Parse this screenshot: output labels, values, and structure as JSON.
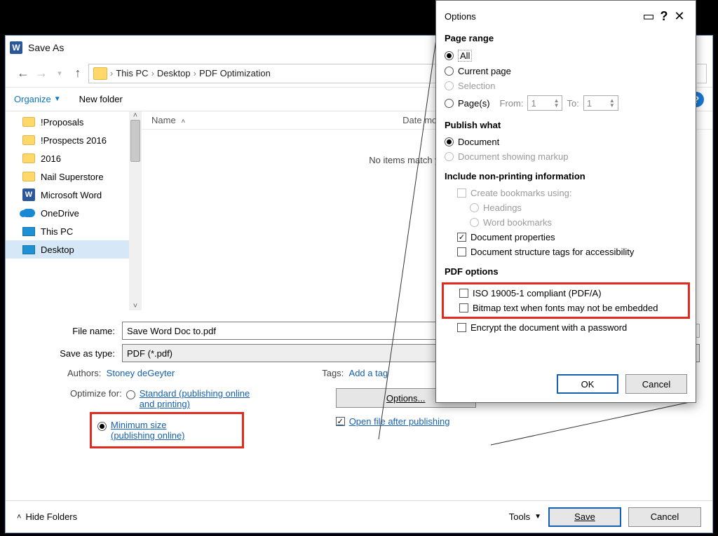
{
  "saveas": {
    "title": "Save As",
    "breadcrumb": [
      "This PC",
      "Desktop",
      "PDF Optimization"
    ],
    "toolbar": {
      "organize": "Organize",
      "newfolder": "New folder"
    },
    "columns": {
      "name": "Name",
      "date": "Date modified"
    },
    "empty": "No items match your search.",
    "tree": [
      {
        "label": "!Proposals",
        "icon": "folder"
      },
      {
        "label": "!Prospects 2016",
        "icon": "folder"
      },
      {
        "label": "2016",
        "icon": "folder"
      },
      {
        "label": "Nail Superstore",
        "icon": "folder"
      },
      {
        "label": "Microsoft Word",
        "icon": "word"
      },
      {
        "label": "OneDrive",
        "icon": "onedrive"
      },
      {
        "label": "This PC",
        "icon": "pc"
      },
      {
        "label": "Desktop",
        "icon": "pc",
        "selected": true
      }
    ],
    "form": {
      "filename_label": "File name:",
      "filename": "Save Word Doc to.pdf",
      "type_label": "Save as type:",
      "type_value": "PDF (*.pdf)",
      "authors_label": "Authors:",
      "authors": "Stoney deGeyter",
      "tags_label": "Tags:",
      "tags": "Add a tag",
      "optimize_label": "Optimize for:",
      "opt_standard": "Standard (publishing online and printing)",
      "opt_min1": "Minimum size",
      "opt_min2": "(publishing online)",
      "options_btn": "Options...",
      "open_after": "Open file after publishing"
    },
    "bottom": {
      "hide": "Hide Folders",
      "tools": "Tools",
      "save": "Save",
      "cancel": "Cancel"
    }
  },
  "options": {
    "title": "Options",
    "page_range": "Page range",
    "all": "All",
    "current": "Current page",
    "selection": "Selection",
    "pages": "Page(s)",
    "from": "From:",
    "to": "To:",
    "from_v": "1",
    "to_v": "1",
    "publish": "Publish what",
    "doc": "Document",
    "docmarkup": "Document showing markup",
    "nonprint": "Include non-printing information",
    "bookmarks": "Create bookmarks using:",
    "headings": "Headings",
    "wordbm": "Word bookmarks",
    "docprops": "Document properties",
    "docstruct": "Document structure tags for accessibility",
    "pdfopt": "PDF options",
    "iso": "ISO 19005-1 compliant (PDF/A)",
    "bitmap": "Bitmap text when fonts may not be embedded",
    "encrypt": "Encrypt the document with a password",
    "ok": "OK",
    "cancel": "Cancel"
  }
}
